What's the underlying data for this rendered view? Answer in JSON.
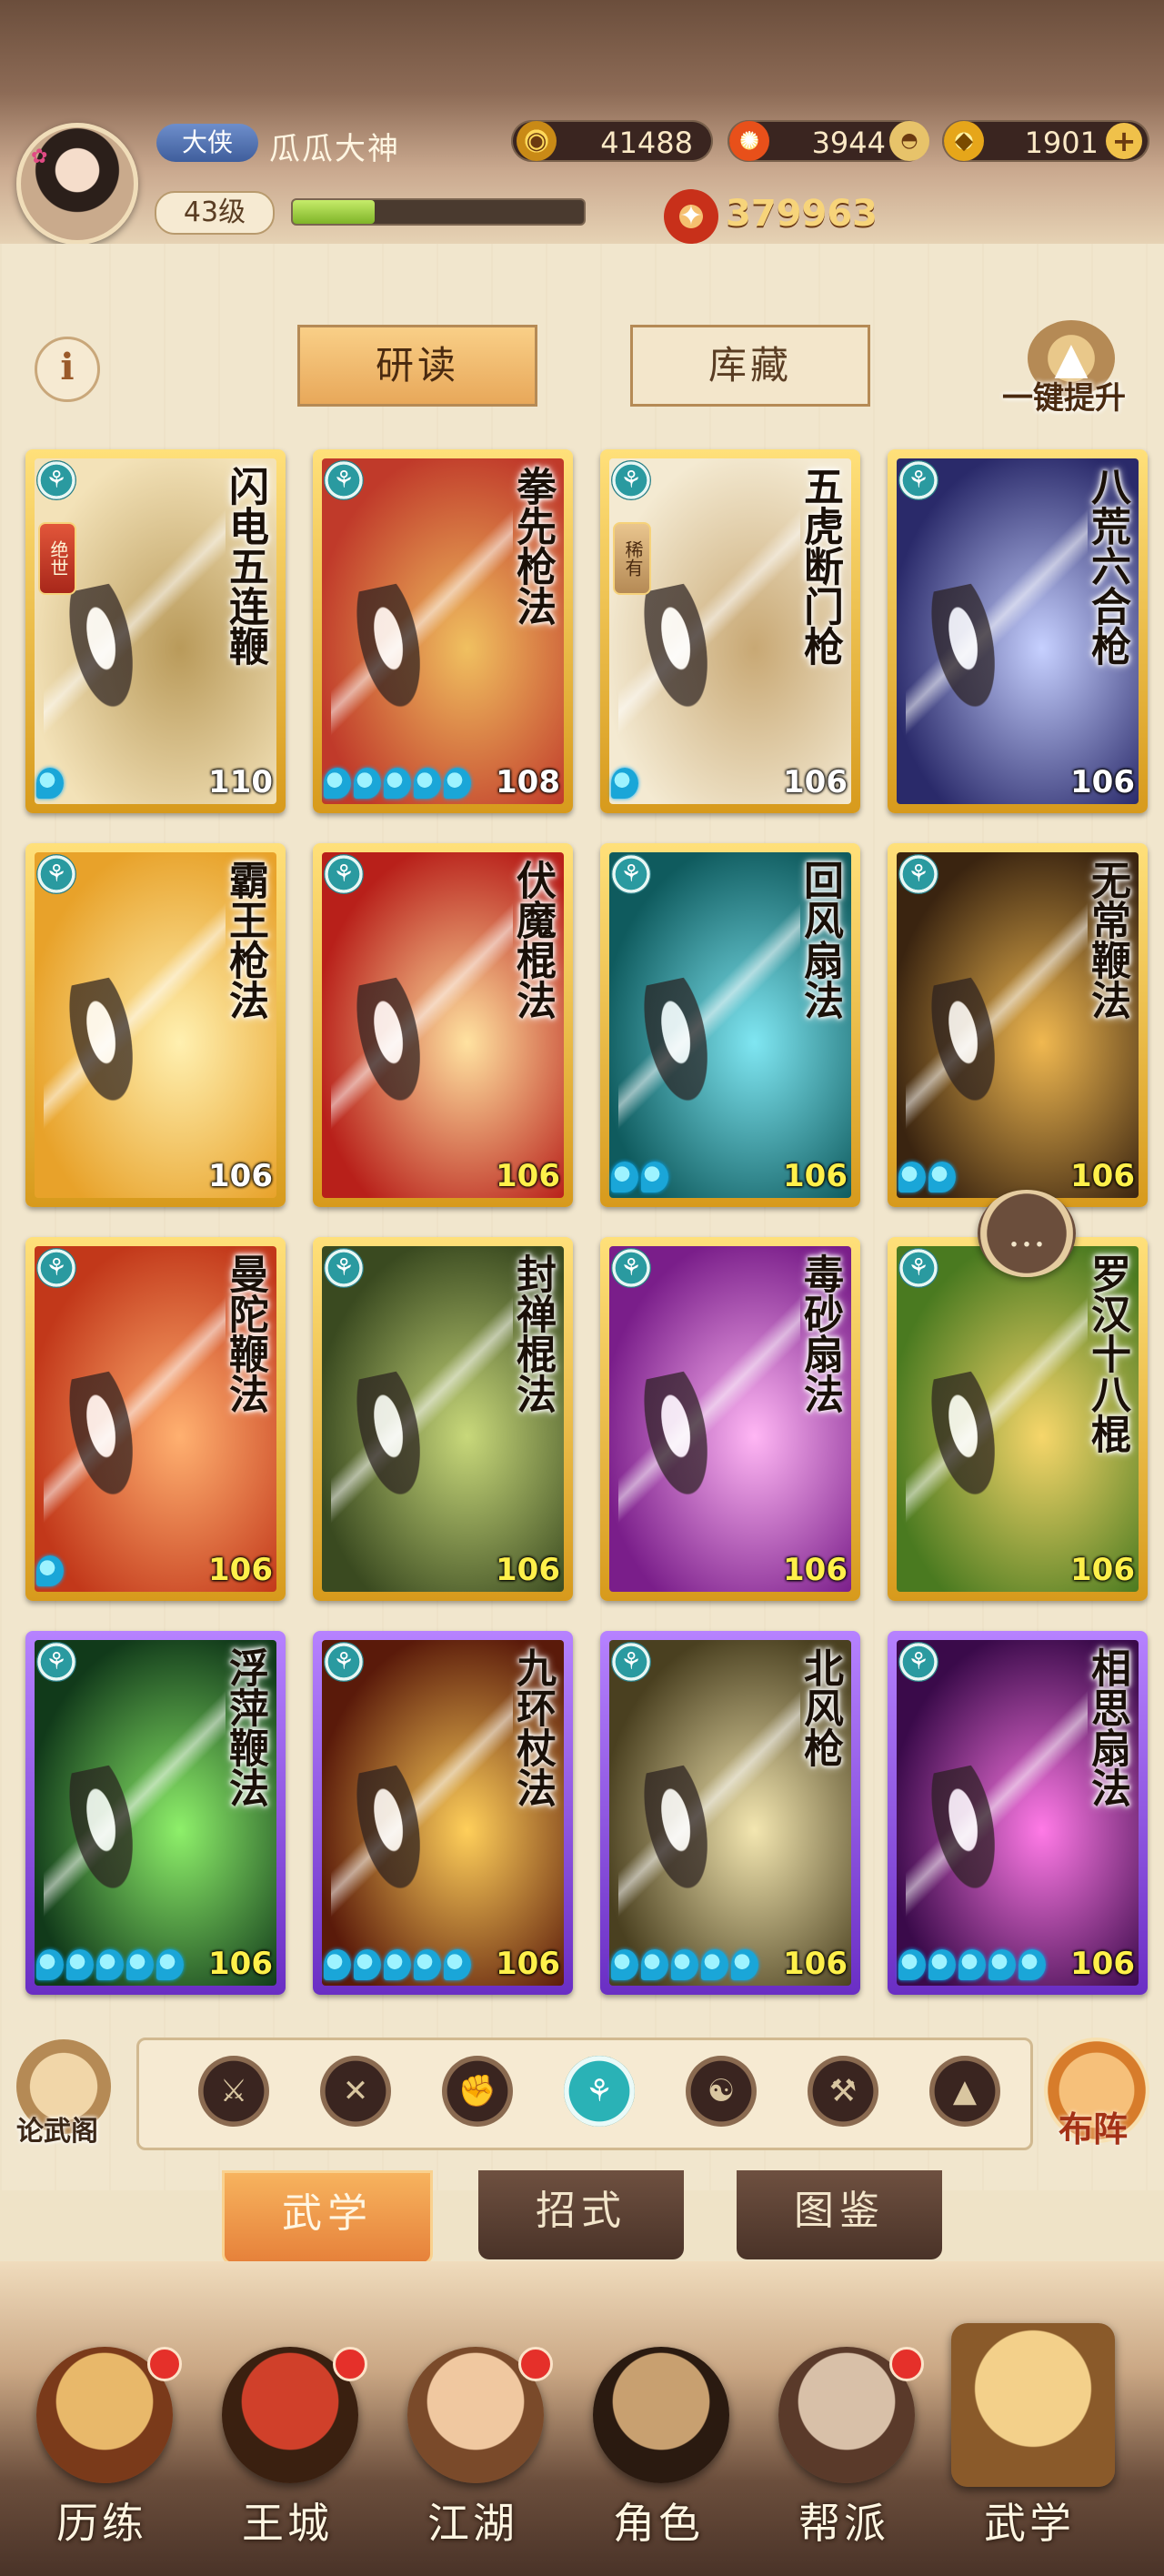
{
  "player": {
    "rank": "大侠",
    "name": "瓜瓜大神",
    "level": "43级",
    "xp_fraction": 0.28
  },
  "resources": {
    "coins": "41488",
    "fire": "3944",
    "gold": "1901",
    "combat_power": "379963"
  },
  "toolbar": {
    "info_label": "i",
    "tab_study": "研读",
    "tab_store": "库藏",
    "upgrade_label": "一键提升"
  },
  "cards": [
    {
      "name": "闪电五连鞭",
      "level": "110",
      "rarity": "绝世",
      "stars": 1,
      "frame": "gold",
      "colors": [
        "#f3e2b8",
        "#b99a5a"
      ]
    },
    {
      "name": "拳先枪法",
      "level": "108",
      "stars": 5,
      "frame": "gold",
      "colors": [
        "#c03a2a",
        "#f0c060"
      ]
    },
    {
      "name": "五虎断门枪",
      "level": "106",
      "rarity": "稀有",
      "stars": 1,
      "frame": "gold",
      "colors": [
        "#f4ead2",
        "#c8a874"
      ]
    },
    {
      "name": "八荒六合枪",
      "level": "106",
      "frame": "gold",
      "colors": [
        "#2a2a6a",
        "#c6d0ff"
      ]
    },
    {
      "name": "霸王枪法",
      "level": "106",
      "frame": "gold",
      "colors": [
        "#e8a22a",
        "#fff0b0"
      ]
    },
    {
      "name": "伏魔棍法",
      "level": "106",
      "frame": "gold",
      "colors": [
        "#b8201a",
        "#ffe2a0"
      ]
    },
    {
      "name": "回风扇法",
      "level": "106",
      "stars": 2,
      "frame": "gold",
      "colors": [
        "#0f5b5e",
        "#7fe6f2"
      ]
    },
    {
      "name": "无常鞭法",
      "level": "106",
      "stars": 2,
      "frame": "gold",
      "colors": [
        "#3a2410",
        "#f0b850"
      ]
    },
    {
      "name": "曼陀鞭法",
      "level": "106",
      "stars": 1,
      "frame": "gold",
      "colors": [
        "#c2381a",
        "#ffb070"
      ]
    },
    {
      "name": "封禅棍法",
      "level": "106",
      "frame": "gold",
      "colors": [
        "#3a4a20",
        "#c8d87a"
      ]
    },
    {
      "name": "毒砂扇法",
      "level": "106",
      "frame": "gold",
      "colors": [
        "#7a1e8a",
        "#ffb6f4"
      ]
    },
    {
      "name": "罗汉十八棍",
      "level": "106",
      "frame": "gold",
      "colors": [
        "#4a7a20",
        "#f6d66a"
      ]
    },
    {
      "name": "浮萍鞭法",
      "level": "106",
      "stars": 5,
      "frame": "purple",
      "colors": [
        "#113a1a",
        "#8ef06a"
      ]
    },
    {
      "name": "九环杖法",
      "level": "106",
      "stars": 5,
      "frame": "purple",
      "colors": [
        "#5a1a0a",
        "#ffcf5a"
      ]
    },
    {
      "name": "北风枪",
      "level": "106",
      "stars": 5,
      "frame": "purple",
      "colors": [
        "#4a4020",
        "#f3e6b0"
      ]
    },
    {
      "name": "相思扇法",
      "level": "106",
      "stars": 5,
      "frame": "purple",
      "colors": [
        "#3a0a4a",
        "#ff7ae6"
      ]
    }
  ],
  "filter_bar": {
    "left_label": "论武阁",
    "right_label": "布阵",
    "icons": [
      "blade-icon",
      "sword-icon",
      "fist-icon",
      "fan-icon",
      "taiji-icon",
      "staff-icon",
      "arrow-up-icon"
    ],
    "active_index": 3
  },
  "section_tabs": [
    "武学",
    "招式",
    "图鉴"
  ],
  "bottom_nav": [
    {
      "label": "历练",
      "badge": true,
      "colors": [
        "#e8b86a",
        "#7a3a1a"
      ]
    },
    {
      "label": "王城",
      "badge": true,
      "colors": [
        "#d0402a",
        "#3a2010"
      ]
    },
    {
      "label": "江湖",
      "badge": true,
      "colors": [
        "#f0c8a0",
        "#7a4a2a"
      ]
    },
    {
      "label": "角色",
      "badge": false,
      "colors": [
        "#c8a070",
        "#2a1a10"
      ]
    },
    {
      "label": "帮派",
      "badge": true,
      "colors": [
        "#d8c0a8",
        "#5a3a2a"
      ]
    },
    {
      "label": "武学",
      "badge": false,
      "colors": [
        "#f3d08a",
        "#8a5a2a"
      ]
    }
  ],
  "colors": {
    "accent": "#e8a85a",
    "xp_green": "#9ed24a",
    "badge_red": "#e5302a"
  }
}
